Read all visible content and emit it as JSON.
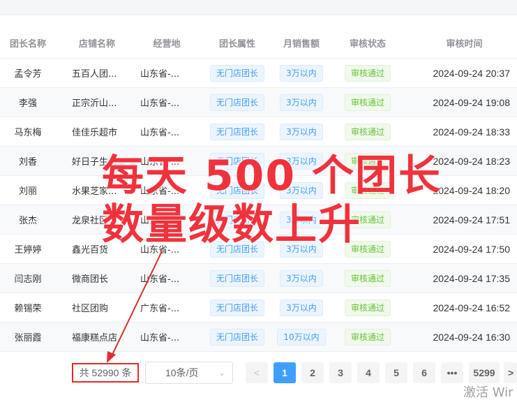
{
  "columns": [
    "团长名称",
    "店铺名称",
    "经营地",
    "团长属性",
    "月销售额",
    "审核状态",
    "审核时间"
  ],
  "rows": [
    {
      "name": "孟令芳",
      "store": "五百人团...",
      "location": "山东省-...",
      "attr": "无门店团长",
      "sales": "3万以内",
      "status": "审核通过",
      "time": "2024-09-24 20:37"
    },
    {
      "name": "李强",
      "store": "正宗沂山...",
      "location": "山东省-...",
      "attr": "无门店团长",
      "sales": "3万以内",
      "status": "审核通过",
      "time": "2024-09-24 19:08"
    },
    {
      "name": "马东梅",
      "store": "佳佳乐超市",
      "location": "山东省-...",
      "attr": "无门店团长",
      "sales": "3万以内",
      "status": "审核通过",
      "time": "2024-09-24 18:33"
    },
    {
      "name": "刘香",
      "store": "好日子生...",
      "location": "山东省-...",
      "attr": "无门店团长",
      "sales": "3万以内",
      "status": "审核通过",
      "time": "2024-09-24 18:23"
    },
    {
      "name": "刘丽",
      "store": "水果芝家...",
      "location": "山东省-...",
      "attr": "无门店团长",
      "sales": "3万以内",
      "status": "审核通过",
      "time": "2024-09-24 18:20"
    },
    {
      "name": "张杰",
      "store": "龙泉社区...",
      "location": "山东省-...",
      "attr": "无门店团长",
      "sales": "3万以内",
      "status": "审核通过",
      "time": "2024-09-24 17:51"
    },
    {
      "name": "王婷婷",
      "store": "鑫光百货",
      "location": "山东省-...",
      "attr": "无门店团长",
      "sales": "3万以内",
      "status": "审核通过",
      "time": "2024-09-24 17:50"
    },
    {
      "name": "闫志刚",
      "store": "微商团长",
      "location": "山东省-...",
      "attr": "无门店团长",
      "sales": "3万以内",
      "status": "审核通过",
      "time": "2024-09-24 17:35"
    },
    {
      "name": "赖锡荣",
      "store": "社区团购",
      "location": "广东省-...",
      "attr": "无门店团长",
      "sales": "3万以内",
      "status": "审核通过",
      "time": "2024-09-24 16:52"
    },
    {
      "name": "张丽霞",
      "store": "福康糕点店",
      "location": "山东省-...",
      "attr": "无门店团长",
      "sales": "10万以内",
      "status": "审核通过",
      "time": "2024-09-24 16:30"
    }
  ],
  "pagination": {
    "total": "共 52990 条",
    "page_size": "10条/页",
    "prev": "<",
    "pages": [
      "1",
      "2",
      "3",
      "4",
      "5",
      "6"
    ],
    "ellipsis": "•••",
    "last": "5299",
    "next": ">",
    "current": "1"
  },
  "overlay": {
    "line1": "每天 500 个团长",
    "line2": "数量级数上升",
    "color": "#f0323c"
  },
  "watermark": "激活 Wir"
}
